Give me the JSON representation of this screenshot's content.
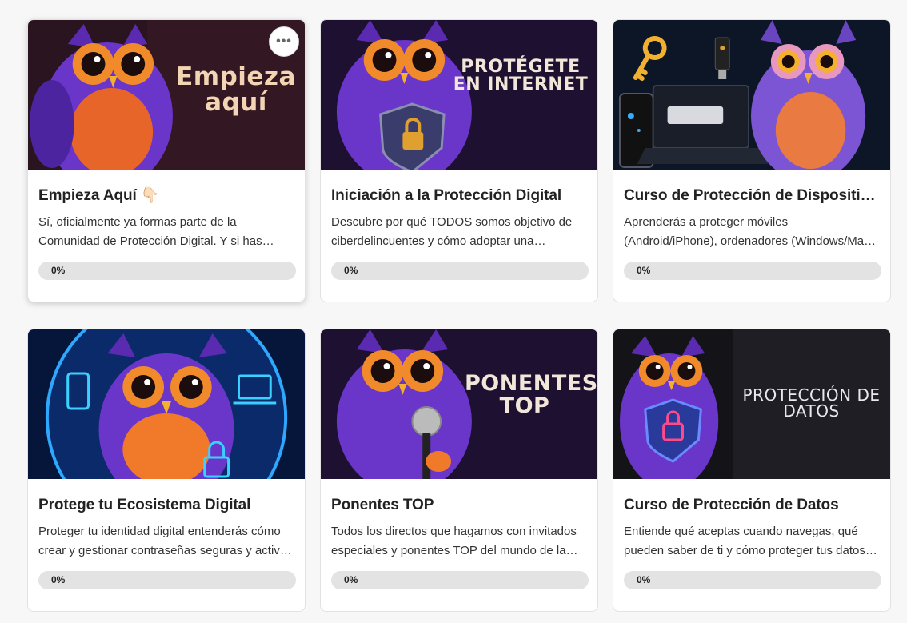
{
  "courses": [
    {
      "title": "Empieza Aquí 👇🏻",
      "description": "Sí, oficialmente ya formas parte de la Comunidad de Protección Digital. Y si has llegado hasta aquí es porque quieres proteger tu vida digital.",
      "progress_label": "0%",
      "progress": 0,
      "banner_text": "Empieza aquí",
      "banner_color": "#f3d4b3",
      "more_label": "•••"
    },
    {
      "title": "Iniciación a la Protección Digital",
      "description": "Descubre por qué TODOS somos objetivo de ciberdelincuentes y cómo adoptar una mentalidad de protección digital.",
      "progress_label": "0%",
      "progress": 0,
      "banner_text": "PROTÉGETE EN INTERNET",
      "banner_color": "#f2e6d8"
    },
    {
      "title": "Curso de Protección de Dispositivos",
      "description": "Aprenderás a proteger móviles (Android/iPhone), ordenadores (Windows/Mac) y todos tus dispositivos.",
      "progress_label": "0%",
      "progress": 0,
      "banner_text": "",
      "banner_color": "#ffffff"
    },
    {
      "title": "Protege tu Ecosistema Digital",
      "description": "Proteger tu identidad digital entenderás cómo crear y gestionar contraseñas seguras y activar la verificación en dos pasos.",
      "progress_label": "0%",
      "progress": 0,
      "banner_text": "",
      "banner_color": "#ffffff"
    },
    {
      "title": "Ponentes TOP",
      "description": "Todos los directos que hagamos con invitados especiales y ponentes TOP del mundo de la ciberseguridad.",
      "progress_label": "0%",
      "progress": 0,
      "banner_text": "PONENTES TOP",
      "banner_color": "#f2e6d8"
    },
    {
      "title": "Curso de Protección de Datos",
      "description": "Entiende qué aceptas cuando navegas, qué pueden saber de ti y cómo proteger tus datos personales.",
      "progress_label": "0%",
      "progress": 0,
      "banner_text": "PROTECCIÓN DE DATOS",
      "banner_color": "#e8e8ee"
    }
  ],
  "colors": {
    "accent": "#6b3bbf",
    "owl_body": "#6a35c9",
    "owl_belly": "#f07a2a",
    "owl_eye": "#f59a2b",
    "track": "#e3e3e3"
  },
  "icons": [
    "more-horizontal-icon",
    "pointing-down-emoji",
    "padlock-icon",
    "shield-icon",
    "key-icon",
    "laptop-icon",
    "phone-icon",
    "microphone-icon",
    "usb-key-icon"
  ]
}
